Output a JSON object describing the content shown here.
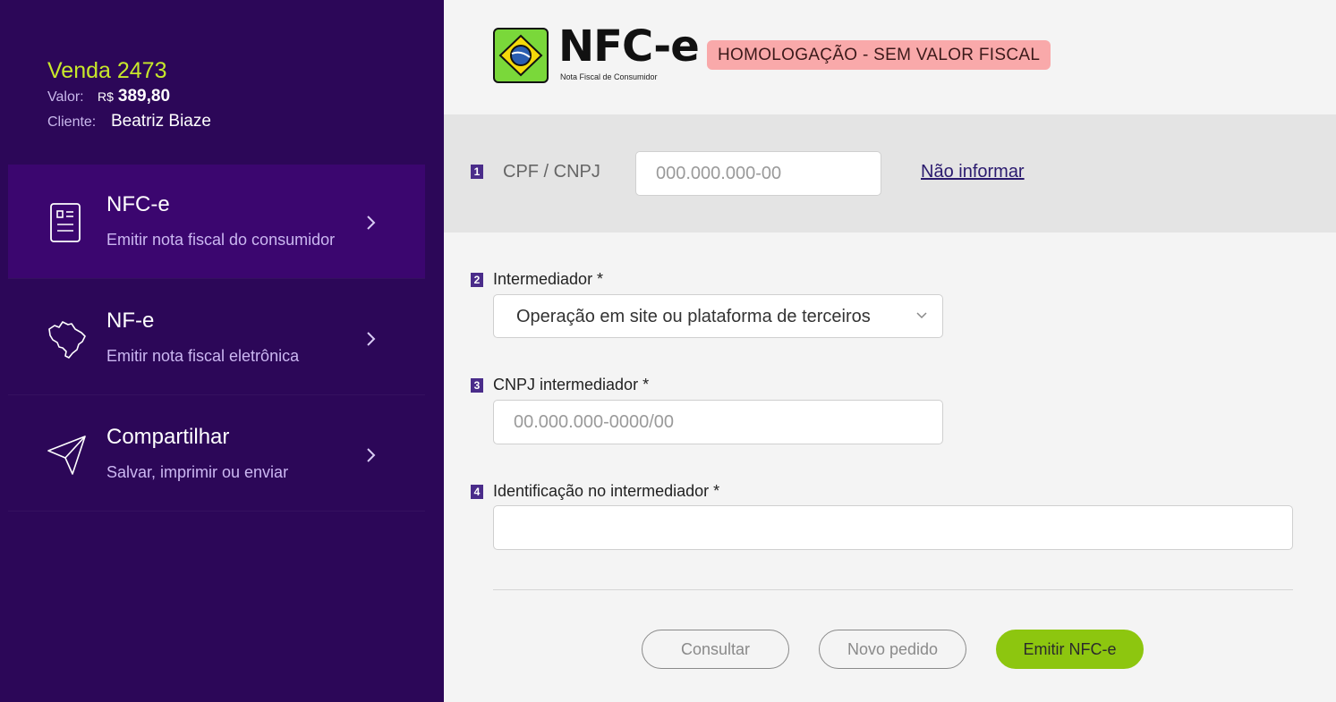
{
  "sale": {
    "title": "Venda 2473",
    "value_label": "Valor:",
    "currency": "R$",
    "amount": "389,80",
    "client_label": "Cliente:",
    "client_name": "Beatriz Biaze"
  },
  "menu": [
    {
      "title": "NFC-e",
      "subtitle": "Emitir nota fiscal do consumidor",
      "icon": "receipt-icon",
      "active": true
    },
    {
      "title": "NF-e",
      "subtitle": "Emitir nota fiscal eletrônica",
      "icon": "brazil-map-icon",
      "active": false
    },
    {
      "title": "Compartilhar",
      "subtitle": "Salvar, imprimir ou enviar",
      "icon": "send-icon",
      "active": false
    }
  ],
  "header": {
    "logo_text": "NFC-e",
    "logo_subtitle": "Nota Fiscal de Consumidor",
    "badge": "HOMOLOGAÇÃO - SEM VALOR FISCAL"
  },
  "form": {
    "cpf": {
      "step": "1",
      "label": "CPF / CNPJ",
      "placeholder": "000.000.000-00",
      "skip_link": "Não informar"
    },
    "intermediador": {
      "step": "2",
      "label": "Intermediador *",
      "selected": "Operação em site ou plataforma de terceiros"
    },
    "cnpj_intermediador": {
      "step": "3",
      "label": "CNPJ intermediador *",
      "placeholder": "00.000.000-0000/00"
    },
    "identificacao": {
      "step": "4",
      "label": "Identificação no intermediador *",
      "value": ""
    }
  },
  "actions": {
    "consultar": "Consultar",
    "novo_pedido": "Novo pedido",
    "emitir": "Emitir NFC-e"
  },
  "colors": {
    "sidebar_bg": "#2c0758",
    "active_item_bg": "#3b066f",
    "sale_title": "#c8e82a",
    "primary_button": "#8dc60f",
    "badge_bg": "#f9a9aa",
    "step_badge": "#4a2c8a"
  }
}
